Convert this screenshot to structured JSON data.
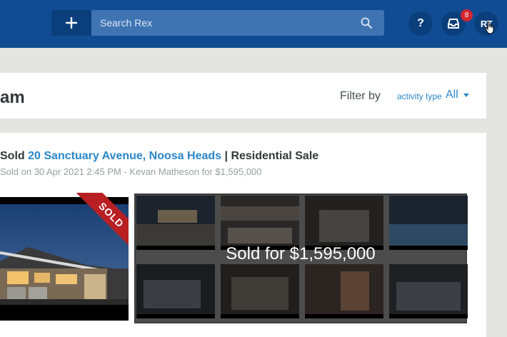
{
  "header": {
    "add_button": "+",
    "search": {
      "placeholder": "Search Rex"
    },
    "help_label": "?",
    "notification_count": "8",
    "avatar_initials": "RT"
  },
  "page": {
    "title": "am",
    "filter": {
      "label": "Filter by",
      "type_label": "activity type",
      "value": "All"
    }
  },
  "activity": {
    "verb": "Sold",
    "address": "20 Sanctuary Avenue, Noosa Heads",
    "separator": "|",
    "listing_type": "Residential Sale",
    "details": "Sold on 30 Apr 2021 2:45 PM - Kevan Matheson for $1,595,000",
    "ribbon": "SOLD",
    "overlay_text": "Sold for $1,595,000"
  },
  "colors": {
    "header": "#0f4c93",
    "link": "#2a86c9",
    "ribbon": "#b81f23",
    "badge": "#d3262f"
  }
}
